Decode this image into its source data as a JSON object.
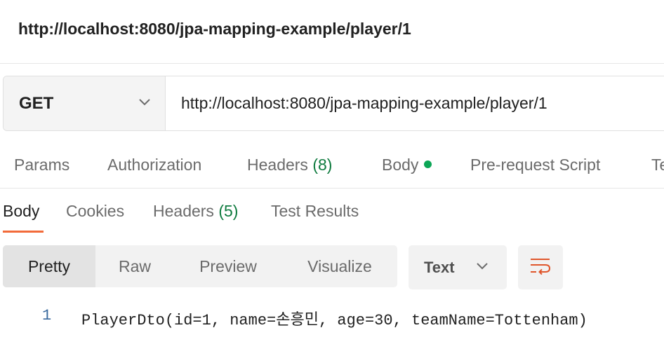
{
  "request": {
    "title": "http://localhost:8080/jpa-mapping-example/player/1",
    "method": "GET",
    "url": "http://localhost:8080/jpa-mapping-example/player/1"
  },
  "request_tabs": [
    {
      "label": "Params"
    },
    {
      "label": "Authorization"
    },
    {
      "label": "Headers",
      "count": "(8)"
    },
    {
      "label": "Body"
    },
    {
      "label": "Pre-request Script"
    },
    {
      "label": "Te"
    }
  ],
  "response_tabs": [
    {
      "label": "Body"
    },
    {
      "label": "Cookies"
    },
    {
      "label": "Headers",
      "count": "(5)"
    },
    {
      "label": "Test Results"
    }
  ],
  "view_modes": [
    "Pretty",
    "Raw",
    "Preview",
    "Visualize"
  ],
  "format": "Text",
  "response": {
    "line_number": "1",
    "content": "PlayerDto(id=1, name=손흥민, age=30, teamName=Tottenham)"
  },
  "colors": {
    "accent": "#f26b3a",
    "count_green": "#0f7b3f",
    "body_dot": "#0ca656",
    "wrap_icon": "#e0562c"
  }
}
